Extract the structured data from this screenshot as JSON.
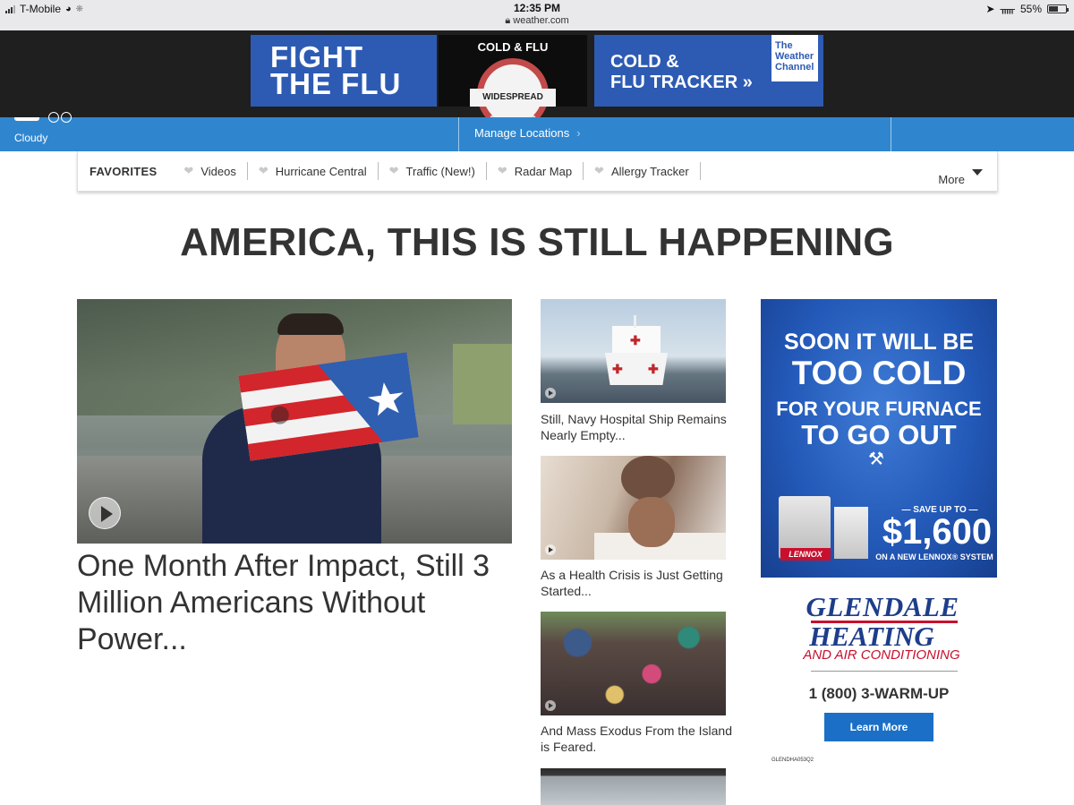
{
  "status_bar": {
    "carrier": "T-Mobile",
    "time": "12:35 PM",
    "url": "weather.com",
    "battery": "55%",
    "battery_level": 0.55
  },
  "top_ad": {
    "left_line1": "FIGHT",
    "left_line2": "THE FLU",
    "mid_title": "COLD & FLU",
    "mid_gauge": "WIDESPREAD",
    "right_line1": "COLD &",
    "right_line2": "FLU TRACKER »",
    "logo_line1": "The",
    "logo_line2": "Weather",
    "logo_line3": "Channel"
  },
  "nav": {
    "condition": "Cloudy",
    "manage_locations": "Manage Locations",
    "manage_chevron": "›"
  },
  "favorites": {
    "title": "FAVORITES",
    "items": [
      "Videos",
      "Hurricane Central",
      "Traffic (New!)",
      "Radar Map",
      "Allergy Tracker"
    ],
    "more": "More"
  },
  "headline": "AMERICA, THIS IS STILL HAPPENING",
  "main_story": {
    "title": "One Month After Impact, Still 3 Million Americans Without Power..."
  },
  "side_stories": [
    {
      "title": "Still, Navy Hospital Ship Remains Nearly Empty..."
    },
    {
      "title": "As a Health Crisis is Just Getting Started..."
    },
    {
      "title": "And Mass Exodus From the Island is Feared."
    }
  ],
  "lennox_ad": {
    "line1": "SOON IT WILL BE",
    "line2": "TOO COLD",
    "line3": "FOR YOUR FURNACE",
    "line4": "TO GO OUT",
    "save_text": "— SAVE UP TO —",
    "save_amount": "$1,600",
    "save_system": "ON A NEW LENNOX® SYSTEM",
    "brand": "LENNOX"
  },
  "glendale_ad": {
    "line1": "GLENDALE",
    "line2": "HEATING",
    "line3": "AND AIR CONDITIONING",
    "phone": "1 (800) 3-WARM-UP",
    "button": "Learn More",
    "code": "GLENDHA053Q2"
  },
  "colors": {
    "nav_blue": "#2f86cf",
    "ad_blue": "#2d5bb3",
    "glendale_blue": "#1e3d8a",
    "glendale_red": "#c8102e"
  }
}
